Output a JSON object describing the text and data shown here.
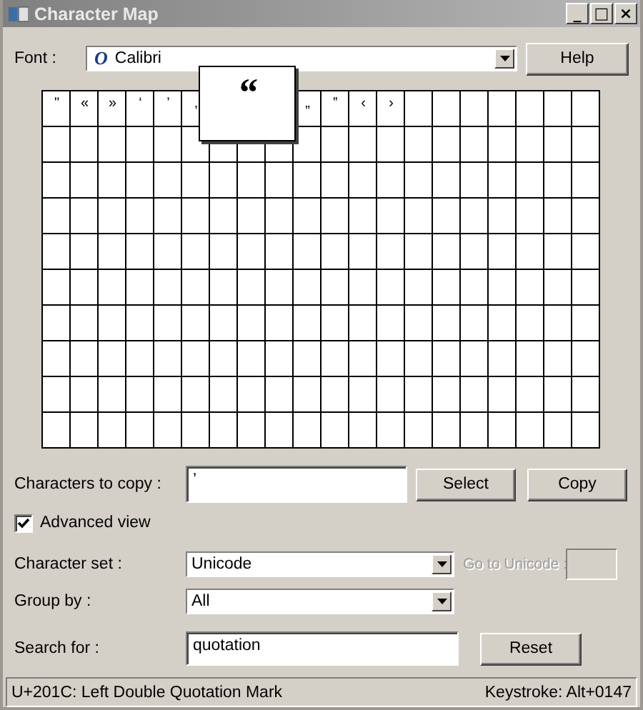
{
  "window": {
    "title": "Character Map",
    "controls": [
      "_",
      "□",
      "×"
    ]
  },
  "font": {
    "label": "Font :",
    "value": "Calibri",
    "font_icon": "O"
  },
  "help_button": "Help",
  "grid": {
    "cells_before_popup": [
      "\"",
      "«",
      "»",
      "‘",
      "’",
      "‚"
    ],
    "cells_after_popup": [
      "„",
      "‟",
      "‹",
      "›"
    ],
    "popup": "“"
  },
  "copy": {
    "label": "Characters to copy :",
    "value": "’",
    "buttons": [
      "Select",
      "Copy"
    ]
  },
  "advanced_view": {
    "label": "Advanced view",
    "checked": true
  },
  "character_set": {
    "label": "Character set :",
    "value": "Unicode"
  },
  "go_to_unicode": {
    "label": "Go to Unicode :",
    "disabled": true
  },
  "group_by": {
    "label": "Group by :",
    "value": "All"
  },
  "search": {
    "label": "Search for :",
    "value": "quotation",
    "button": "Reset"
  },
  "status_bar": {
    "left": "U+201C: Left Double Quotation Mark",
    "right": "Keystroke: Alt+0147"
  }
}
